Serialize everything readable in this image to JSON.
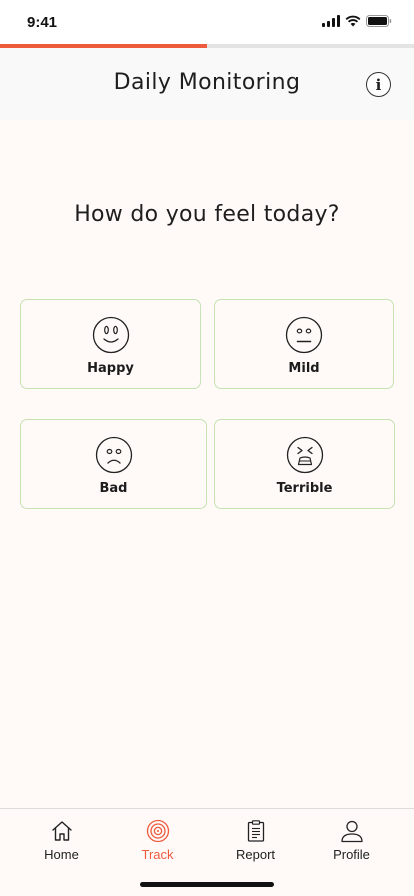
{
  "status_bar": {
    "time": "9:41"
  },
  "progress": {
    "fraction": 0.5,
    "color": "#ee5a3c"
  },
  "header": {
    "title": "Daily Monitoring",
    "info_icon": "info-icon"
  },
  "question": "How do you feel today?",
  "moods": [
    {
      "label": "Happy",
      "icon": "happy-face-icon"
    },
    {
      "label": "Mild",
      "icon": "neutral-face-icon"
    },
    {
      "label": "Bad",
      "icon": "sad-face-icon"
    },
    {
      "label": "Terrible",
      "icon": "distressed-face-icon"
    }
  ],
  "tabs": [
    {
      "label": "Home",
      "icon": "home-icon",
      "active": false
    },
    {
      "label": "Track",
      "icon": "target-icon",
      "active": true
    },
    {
      "label": "Report",
      "icon": "clipboard-icon",
      "active": false
    },
    {
      "label": "Profile",
      "icon": "person-icon",
      "active": false
    }
  ],
  "colors": {
    "accent": "#ee5a3c",
    "card_border": "#c4e2b2",
    "background": "#fffaf8"
  }
}
